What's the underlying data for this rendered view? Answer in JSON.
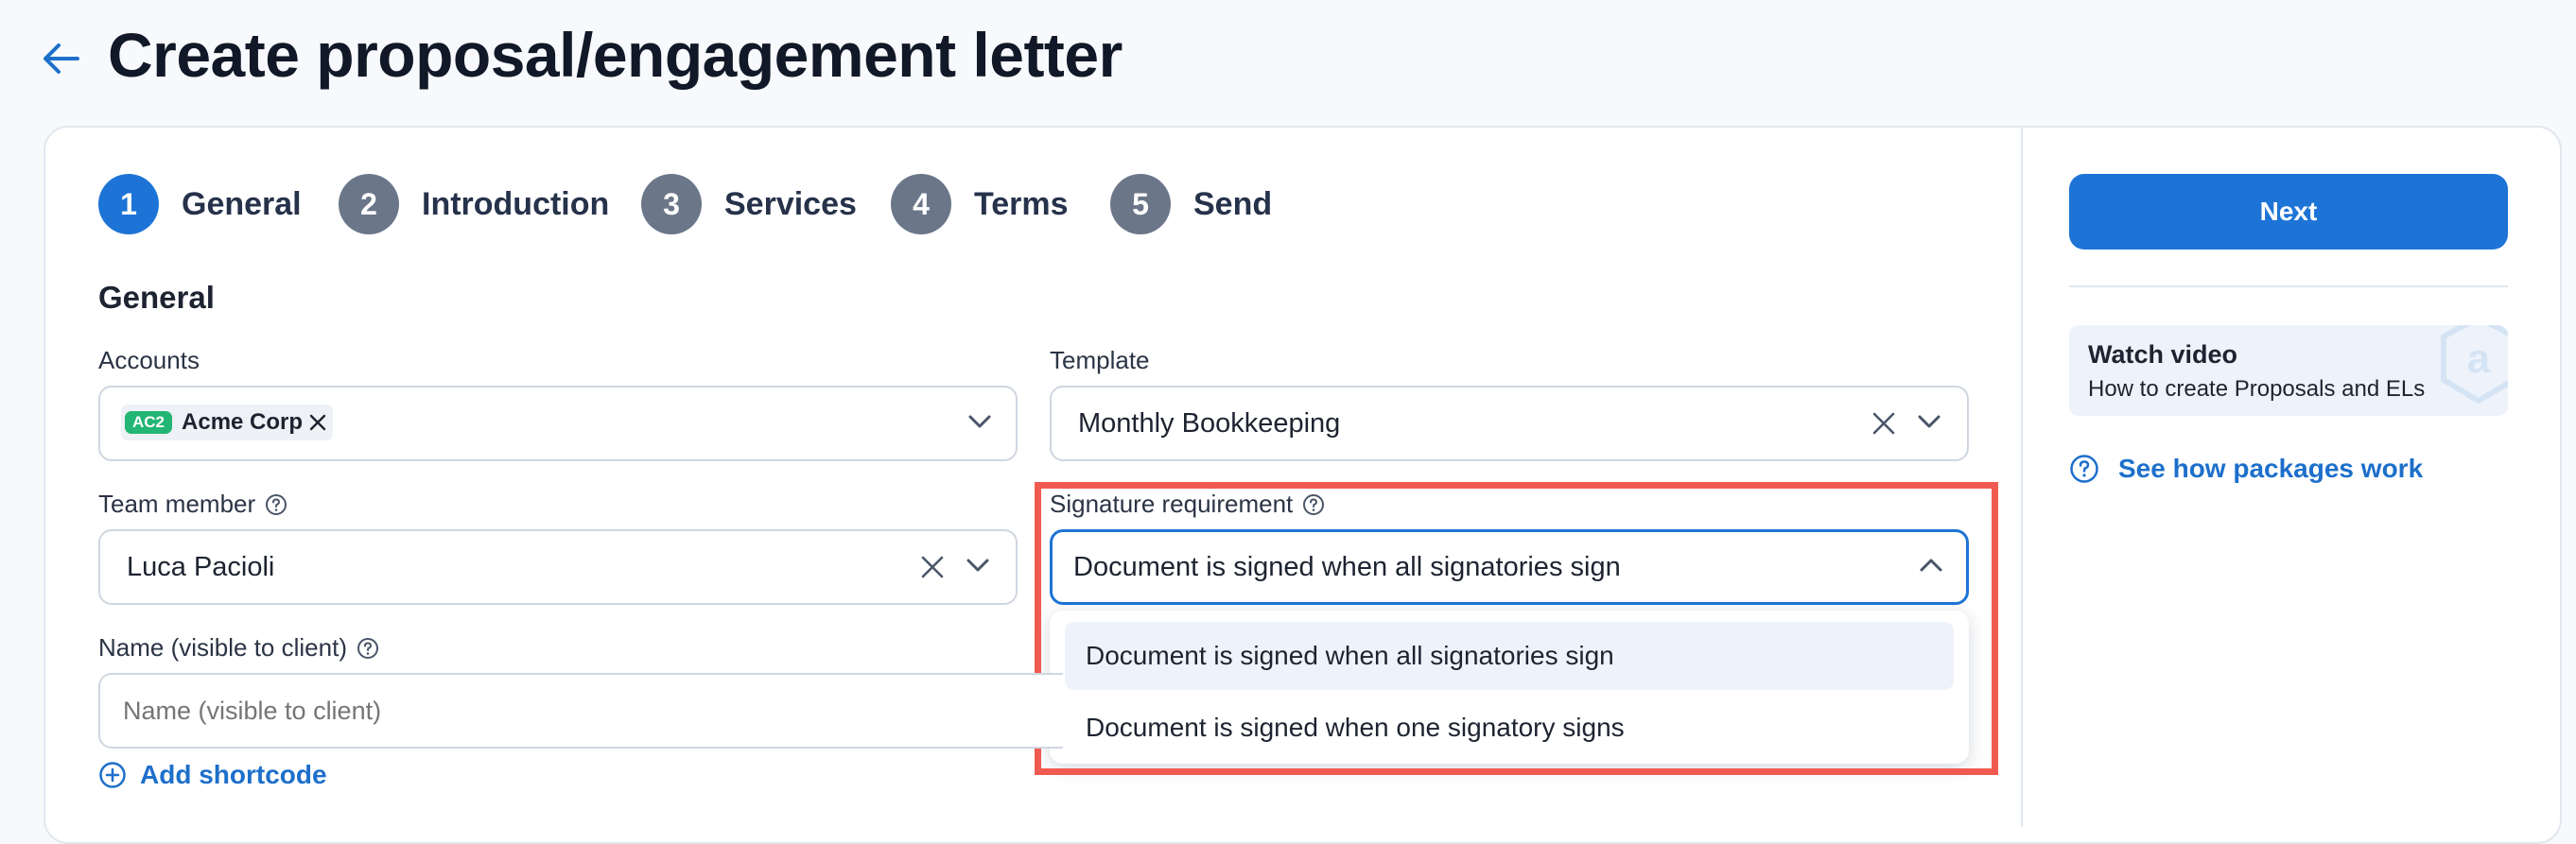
{
  "header": {
    "title": "Create proposal/engagement letter"
  },
  "steps": [
    {
      "number": "1",
      "label": "General",
      "active": true
    },
    {
      "number": "2",
      "label": "Introduction",
      "active": false
    },
    {
      "number": "3",
      "label": "Services",
      "active": false
    },
    {
      "number": "4",
      "label": "Terms",
      "active": false
    },
    {
      "number": "5",
      "label": "Send",
      "active": false
    }
  ],
  "form": {
    "section_title": "General",
    "accounts": {
      "label": "Accounts",
      "chip_badge": "AC2",
      "chip_label": "Acme Corp"
    },
    "template": {
      "label": "Template",
      "value": "Monthly Bookkeeping"
    },
    "team_member": {
      "label": "Team member",
      "value": "Luca Pacioli"
    },
    "signature_requirement": {
      "label": "Signature requirement",
      "value": "Document is signed when all signatories sign",
      "options": [
        "Document is signed when all signatories sign",
        "Document is signed when one signatory signs"
      ]
    },
    "name": {
      "label": "Name (visible to client)",
      "placeholder": "Name (visible to client)"
    },
    "add_shortcode_label": "Add shortcode"
  },
  "sidebar": {
    "next_label": "Next",
    "video": {
      "title": "Watch video",
      "subtitle": "How to create Proposals and ELs"
    },
    "packages_link": "See how packages work"
  },
  "colors": {
    "primary": "#1d74d6",
    "step_inactive": "#6b7689",
    "highlight": "#f15a50",
    "badge_green": "#22b573"
  }
}
